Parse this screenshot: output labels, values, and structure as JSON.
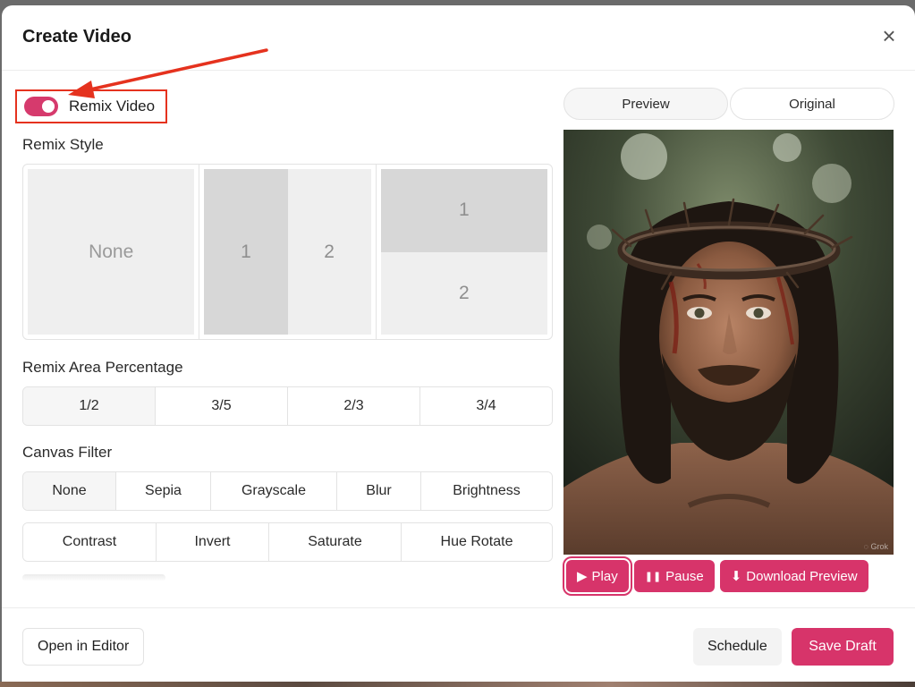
{
  "modal": {
    "title": "Create Video",
    "close_icon": "close-icon"
  },
  "remix": {
    "toggle_label": "Remix Video",
    "toggle_on": true,
    "toggle_color": "#d63a6d"
  },
  "remix_style": {
    "label": "Remix Style",
    "options": [
      {
        "id": "none",
        "label": "None"
      },
      {
        "id": "side-by-side",
        "parts": [
          "1",
          "2"
        ]
      },
      {
        "id": "stacked",
        "parts": [
          "1",
          "2"
        ]
      }
    ]
  },
  "remix_area": {
    "label": "Remix Area Percentage",
    "options": [
      "1/2",
      "3/5",
      "2/3",
      "3/4"
    ],
    "selected": "1/2"
  },
  "canvas_filter": {
    "label": "Canvas Filter",
    "row1": [
      "None",
      "Sepia",
      "Grayscale",
      "Blur",
      "Brightness"
    ],
    "row2": [
      "Contrast",
      "Invert",
      "Saturate",
      "Hue Rotate"
    ],
    "selected": "None"
  },
  "preview": {
    "tabs": [
      "Preview",
      "Original"
    ],
    "active_tab": "Preview",
    "watermark": "Grok",
    "controls": {
      "play": "Play",
      "pause": "Pause",
      "download": "Download Preview"
    }
  },
  "footer": {
    "open_editor": "Open in Editor",
    "schedule": "Schedule",
    "save_draft": "Save Draft"
  },
  "accent_color": "#d7346a",
  "annotation_color": "#e5321e"
}
